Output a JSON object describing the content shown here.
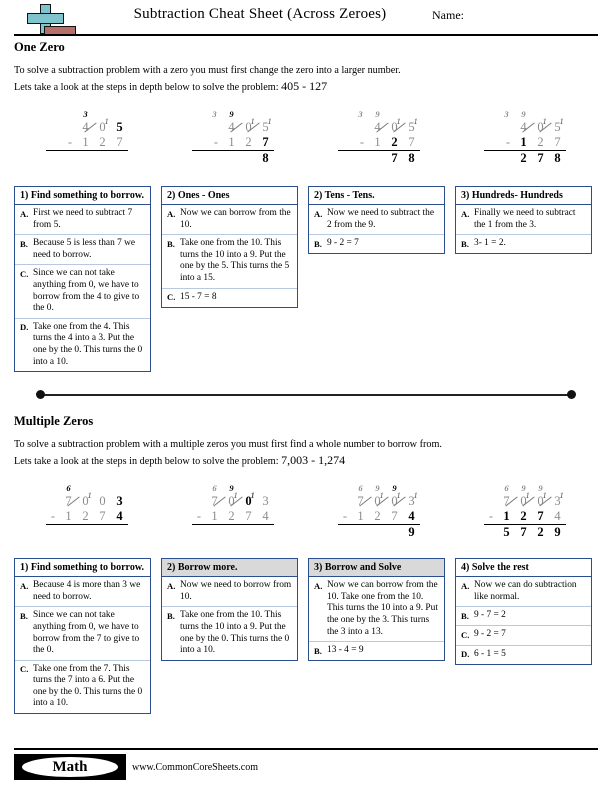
{
  "header": {
    "title": "Subtraction Cheat Sheet (Across Zeroes)",
    "name_label": "Name:",
    "logo_plus": "plus-symbol",
    "logo_minus": "minus-symbol"
  },
  "section_one": {
    "heading": "One Zero",
    "line1": "To solve a subtraction problem with a zero you must first change the zero into a larger number.",
    "line2_prefix": "Lets take a look at the steps in depth below to solve the problem:",
    "problem": "405 - 127",
    "problems": [
      {
        "marks": [
          "",
          "3",
          "",
          ""
        ],
        "marks_dark": [
          false,
          true,
          false,
          false
        ],
        "minuend": [
          {
            "d": "4",
            "struck": true,
            "sup": "",
            "active": false
          },
          {
            "d": "0",
            "struck": false,
            "sup": "1",
            "active": false
          },
          {
            "d": "5",
            "struck": false,
            "sup": "",
            "active": true
          }
        ],
        "subtrahend": [
          "1",
          "2",
          "7"
        ],
        "subtrahend_active": [
          false,
          false,
          false
        ],
        "answer": [
          "",
          "",
          ""
        ],
        "answer_active": [
          false,
          false,
          false
        ]
      },
      {
        "marks": [
          "3",
          "9",
          "",
          ""
        ],
        "marks_dark": [
          false,
          true,
          false,
          false
        ],
        "minuend": [
          {
            "d": "4",
            "struck": true,
            "sup": "",
            "active": false
          },
          {
            "d": "0",
            "struck": true,
            "sup": "1",
            "active": false
          },
          {
            "d": "5",
            "struck": false,
            "sup": "1",
            "active": false
          }
        ],
        "subtrahend": [
          "1",
          "2",
          "7"
        ],
        "subtrahend_active": [
          false,
          false,
          true
        ],
        "answer": [
          "",
          "",
          "8"
        ],
        "answer_active": [
          false,
          false,
          true
        ]
      },
      {
        "marks": [
          "3",
          "9",
          "",
          ""
        ],
        "marks_dark": [
          false,
          false,
          false,
          false
        ],
        "minuend": [
          {
            "d": "4",
            "struck": true,
            "sup": "",
            "active": false
          },
          {
            "d": "0",
            "struck": true,
            "sup": "1",
            "active": false
          },
          {
            "d": "5",
            "struck": false,
            "sup": "1",
            "active": false
          }
        ],
        "subtrahend": [
          "1",
          "2",
          "7"
        ],
        "subtrahend_active": [
          false,
          true,
          false
        ],
        "answer": [
          "",
          "7",
          "8"
        ],
        "answer_active": [
          false,
          true,
          true
        ]
      },
      {
        "marks": [
          "3",
          "9",
          "",
          ""
        ],
        "marks_dark": [
          false,
          false,
          false,
          false
        ],
        "minuend": [
          {
            "d": "4",
            "struck": true,
            "sup": "",
            "active": false
          },
          {
            "d": "0",
            "struck": true,
            "sup": "1",
            "active": false
          },
          {
            "d": "5",
            "struck": false,
            "sup": "1",
            "active": false
          }
        ],
        "subtrahend": [
          "1",
          "2",
          "7"
        ],
        "subtrahend_active": [
          true,
          false,
          false
        ],
        "answer": [
          "2",
          "7",
          "8"
        ],
        "answer_active": [
          true,
          true,
          true
        ]
      }
    ],
    "steps": [
      {
        "title": "1) Find something to borrow.",
        "grey": false,
        "items": [
          {
            "letter": "A.",
            "text": "First we need to subtract 7 from 5."
          },
          {
            "letter": "B.",
            "text": "Because 5 is less than 7 we need to borrow."
          },
          {
            "letter": "C.",
            "text": "Since we can not take anything from 0, we have to borrow from the 4 to give to the 0."
          },
          {
            "letter": "D.",
            "text": "Take one from the 4. This turns the 4 into a 3. Put the one by the 0. This turns the 0 into a 10."
          }
        ]
      },
      {
        "title": "2) Ones - Ones",
        "grey": false,
        "items": [
          {
            "letter": "A.",
            "text": "Now we can borrow from the 10."
          },
          {
            "letter": "B.",
            "text": "Take one from the 10. This turns the 10 into a 9. Put the one by the 5. This turns the 5 into a 15."
          },
          {
            "letter": "C.",
            "text": "15 - 7 = 8"
          }
        ]
      },
      {
        "title": "2) Tens - Tens.",
        "grey": false,
        "items": [
          {
            "letter": "A.",
            "text": "Now we need to subtract the 2 from the 9."
          },
          {
            "letter": "B.",
            "text": "9 - 2 = 7"
          }
        ]
      },
      {
        "title": "3) Hundreds- Hundreds",
        "grey": false,
        "items": [
          {
            "letter": "A.",
            "text": "Finally we need to subtract the 1 from the 3."
          },
          {
            "letter": "B.",
            "text": "3- 1 = 2."
          }
        ]
      }
    ]
  },
  "section_two": {
    "heading": "Multiple Zeros",
    "line1": "To solve a subtraction problem with a  multiple zeros you must first find a whole number to borrow from.",
    "line2_prefix": "Lets take a look at the steps in depth below to solve the problem:",
    "problem": "7,003 - 1,274",
    "problems": [
      {
        "marks": [
          "6",
          "",
          "",
          ""
        ],
        "marks_dark": [
          true,
          false,
          false,
          false
        ],
        "minuend": [
          {
            "d": "7",
            "struck": true,
            "sup": "",
            "active": false
          },
          {
            "d": "0",
            "struck": false,
            "sup": "1",
            "active": false
          },
          {
            "d": "0",
            "struck": false,
            "sup": "",
            "active": false
          },
          {
            "d": "3",
            "struck": false,
            "sup": "",
            "active": true
          }
        ],
        "subtrahend": [
          "1",
          "2",
          "7",
          "4"
        ],
        "subtrahend_active": [
          false,
          false,
          false,
          true
        ],
        "answer": [
          "",
          "",
          "",
          ""
        ],
        "answer_active": [
          false,
          false,
          false,
          false
        ]
      },
      {
        "marks": [
          "6",
          "9",
          "",
          ""
        ],
        "marks_dark": [
          false,
          true,
          false,
          false
        ],
        "minuend": [
          {
            "d": "7",
            "struck": true,
            "sup": "",
            "active": false
          },
          {
            "d": "0",
            "struck": true,
            "sup": "1",
            "active": false
          },
          {
            "d": "0",
            "struck": false,
            "sup": "1",
            "active": true
          },
          {
            "d": "3",
            "struck": false,
            "sup": "",
            "active": false
          }
        ],
        "subtrahend": [
          "1",
          "2",
          "7",
          "4"
        ],
        "subtrahend_active": [
          false,
          false,
          false,
          false
        ],
        "answer": [
          "",
          "",
          "",
          ""
        ],
        "answer_active": [
          false,
          false,
          false,
          false
        ]
      },
      {
        "marks": [
          "6",
          "9",
          "9",
          ""
        ],
        "marks_dark": [
          false,
          false,
          true,
          false
        ],
        "minuend": [
          {
            "d": "7",
            "struck": true,
            "sup": "",
            "active": false
          },
          {
            "d": "0",
            "struck": true,
            "sup": "1",
            "active": false
          },
          {
            "d": "0",
            "struck": true,
            "sup": "1",
            "active": false
          },
          {
            "d": "3",
            "struck": false,
            "sup": "1",
            "active": false
          }
        ],
        "subtrahend": [
          "1",
          "2",
          "7",
          "4"
        ],
        "subtrahend_active": [
          false,
          false,
          false,
          true
        ],
        "answer": [
          "",
          "",
          "",
          "9"
        ],
        "answer_active": [
          false,
          false,
          false,
          true
        ]
      },
      {
        "marks": [
          "6",
          "9",
          "9",
          ""
        ],
        "marks_dark": [
          false,
          false,
          false,
          false
        ],
        "minuend": [
          {
            "d": "7",
            "struck": true,
            "sup": "",
            "active": false
          },
          {
            "d": "0",
            "struck": true,
            "sup": "1",
            "active": false
          },
          {
            "d": "0",
            "struck": true,
            "sup": "1",
            "active": false
          },
          {
            "d": "3",
            "struck": false,
            "sup": "1",
            "active": false
          }
        ],
        "subtrahend": [
          "1",
          "2",
          "7",
          "4"
        ],
        "subtrahend_active": [
          true,
          true,
          true,
          false
        ],
        "answer": [
          "5",
          "7",
          "2",
          "9"
        ],
        "answer_active": [
          true,
          true,
          true,
          true
        ]
      }
    ],
    "steps": [
      {
        "title": "1) Find something to borrow.",
        "grey": false,
        "items": [
          {
            "letter": "A.",
            "text": "Because 4 is more than 3 we need to borrow."
          },
          {
            "letter": "B.",
            "text": "Since we can not take anything from 0, we have to borrow from the 7 to give to the 0."
          },
          {
            "letter": "C.",
            "text": "Take one from the 7. This turns the 7 into a 6. Put the one by the 0. This turns the 0 into a 10."
          }
        ]
      },
      {
        "title": "2) Borrow more.",
        "grey": true,
        "items": [
          {
            "letter": "A.",
            "text": "Now we need to borrow from 10."
          },
          {
            "letter": "B.",
            "text": "Take one from the 10. This turns the 10 into a 9. Put the one by the 0. This turns the 0 into a 10."
          }
        ]
      },
      {
        "title": "3) Borrow and Solve",
        "grey": true,
        "items": [
          {
            "letter": "A.",
            "text": "Now we can borrow from the 10. Take one from the 10. This turns the 10 into a 9. Put the one by the 3. This turns the 3 into a 13."
          },
          {
            "letter": "B.",
            "text": "13 - 4 = 9"
          }
        ]
      },
      {
        "title": "4) Solve the rest",
        "grey": false,
        "items": [
          {
            "letter": "A.",
            "text": "Now we can do subtraction like normal."
          },
          {
            "letter": "B.",
            "text": "9 - 7 = 2"
          },
          {
            "letter": "C.",
            "text": "9 - 2 = 7"
          },
          {
            "letter": "D.",
            "text": "6 - 1 = 5"
          }
        ]
      }
    ]
  },
  "footer": {
    "badge": "Math",
    "site": "www.CommonCoreSheets.com"
  }
}
